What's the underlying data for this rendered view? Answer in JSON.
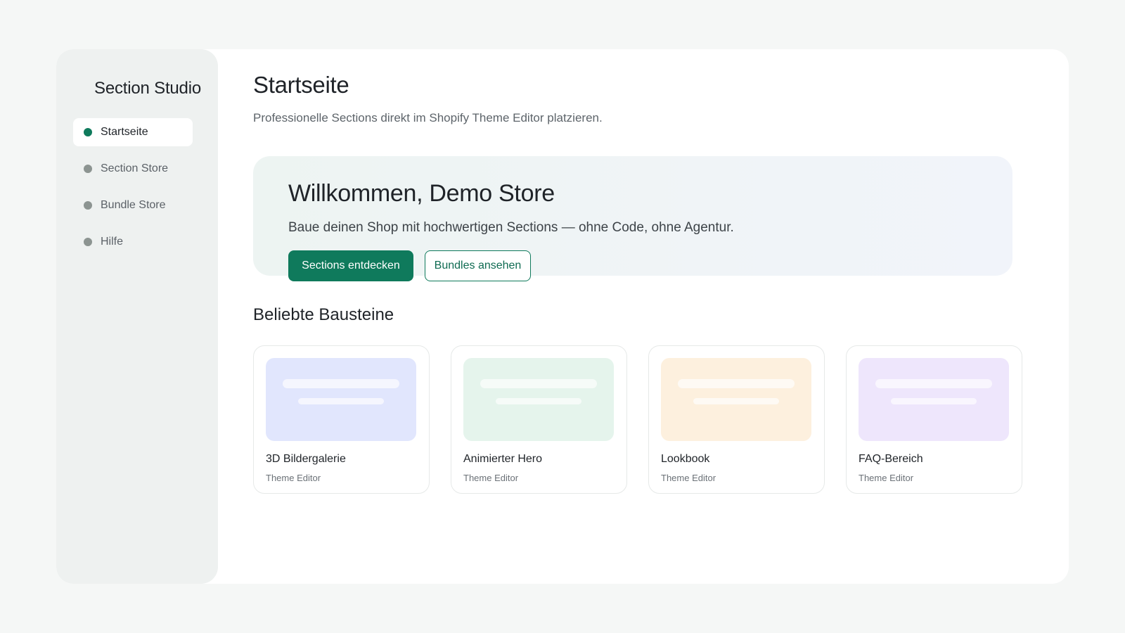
{
  "sidebar": {
    "brand": "Section Studio",
    "items": [
      {
        "label": "Startseite",
        "active": true
      },
      {
        "label": "Section Store",
        "active": false
      },
      {
        "label": "Bundle Store",
        "active": false
      },
      {
        "label": "Hilfe",
        "active": false
      }
    ]
  },
  "header": {
    "title": "Startseite",
    "subtitle": "Professionelle Sections direkt im Shopify Theme Editor platzieren."
  },
  "hero": {
    "title": "Willkommen, Demo Store",
    "text": "Baue deinen Shop mit hochwertigen Sections — ohne Code, ohne Agentur.",
    "primary_button": "Sections entdecken",
    "secondary_button": "Bundles ansehen"
  },
  "popular": {
    "title": "Beliebte Bausteine",
    "cards": [
      {
        "title": "3D Bildergalerie",
        "meta": "Theme Editor",
        "thumb_color": "#e1e6fd"
      },
      {
        "title": "Animierter Hero",
        "meta": "Theme Editor",
        "thumb_color": "#e5f4ec"
      },
      {
        "title": "Lookbook",
        "meta": "Theme Editor",
        "thumb_color": "#fdf0de"
      },
      {
        "title": "FAQ-Bereich",
        "meta": "Theme Editor",
        "thumb_color": "#eee6fc"
      }
    ]
  },
  "colors": {
    "accent": "#0f7a5c",
    "background": "#f5f7f6",
    "sidebar": "#eef1f0"
  }
}
